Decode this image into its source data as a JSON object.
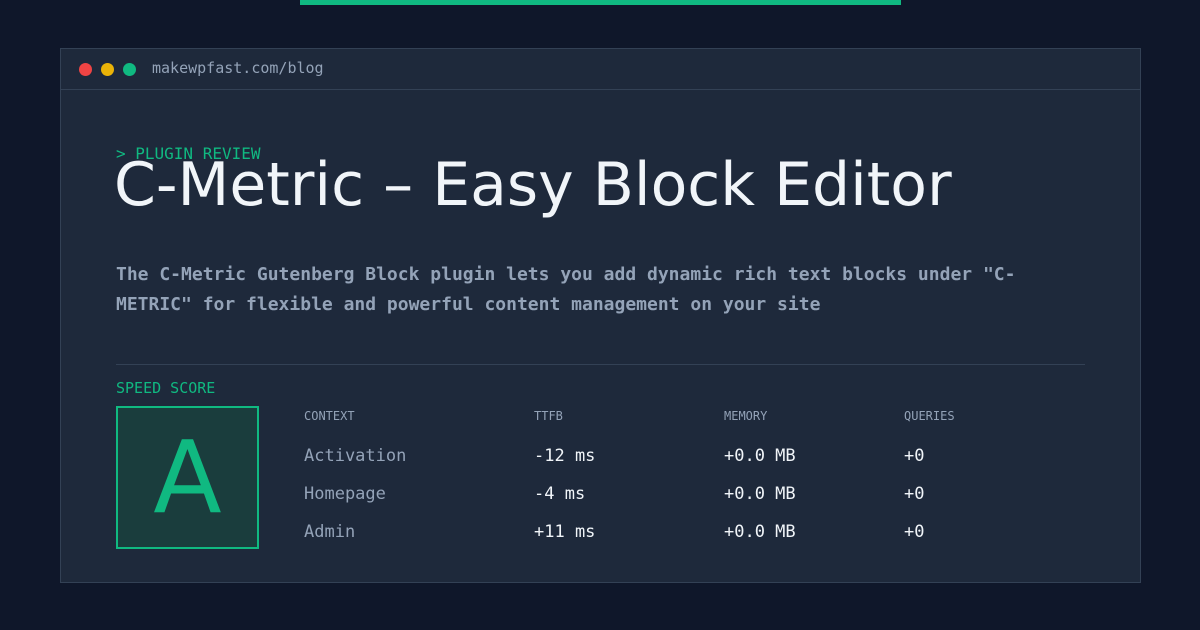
{
  "browser": {
    "url": "makewpfast.com/blog"
  },
  "article": {
    "kicker": "> PLUGIN REVIEW",
    "title": "C-Metric – Easy Block Editor",
    "description": "The C-Metric Gutenberg Block plugin lets you add dynamic rich text blocks under \"C-METRIC\" for flexible and powerful content management on your site"
  },
  "speed_score": {
    "label": "SPEED SCORE",
    "grade": "A"
  },
  "metrics": {
    "columns": [
      "CONTEXT",
      "TTFB",
      "MEMORY",
      "QUERIES"
    ],
    "rows": [
      [
        "Activation",
        "-12 ms",
        "+0.0 MB",
        "+0"
      ],
      [
        "Homepage",
        "-4 ms",
        "+0.0 MB",
        "+0"
      ],
      [
        "Admin",
        "+11 ms",
        "+0.0 MB",
        "+0"
      ]
    ]
  },
  "colors": {
    "accent": "#10b981",
    "background": "#0f172a",
    "panel": "#1e293b",
    "border": "#334155",
    "text": "#f1f5f9",
    "muted": "#94a3b8",
    "window_red": "#ef4444",
    "window_yellow": "#eab308",
    "window_green": "#10b981"
  }
}
